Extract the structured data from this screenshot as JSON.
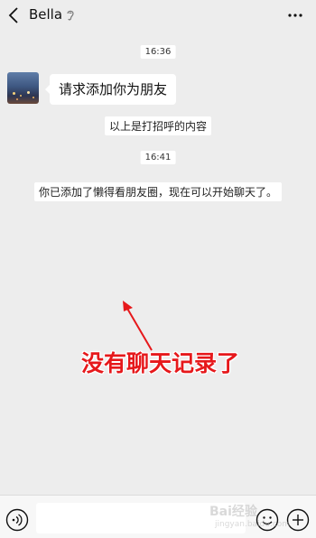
{
  "header": {
    "back_icon": "chevron-left-icon",
    "title": "Bella",
    "ear_icon": "ear-icon",
    "more_icon": "more-dots-icon"
  },
  "messages": {
    "timestamp_1": "16:36",
    "friend_bubble": "请求添加你为朋友",
    "system_1": "以上是打招呼的内容",
    "timestamp_2": "16:41",
    "system_2": "你已添加了懒得看朋友圈，现在可以开始聊天了。"
  },
  "annotation": {
    "text": "没有聊天记录了",
    "color": "#e6181b"
  },
  "bottom_bar": {
    "voice_icon": "voice-icon",
    "input_value": "",
    "emoji_icon": "emoji-icon",
    "plus_icon": "plus-circle-icon"
  },
  "watermark": {
    "line1": "Bai经验",
    "line2": "jingyan.baidu.com"
  },
  "colors": {
    "background": "#ededed",
    "bubble": "#ffffff",
    "annotation_red": "#e6181b"
  }
}
